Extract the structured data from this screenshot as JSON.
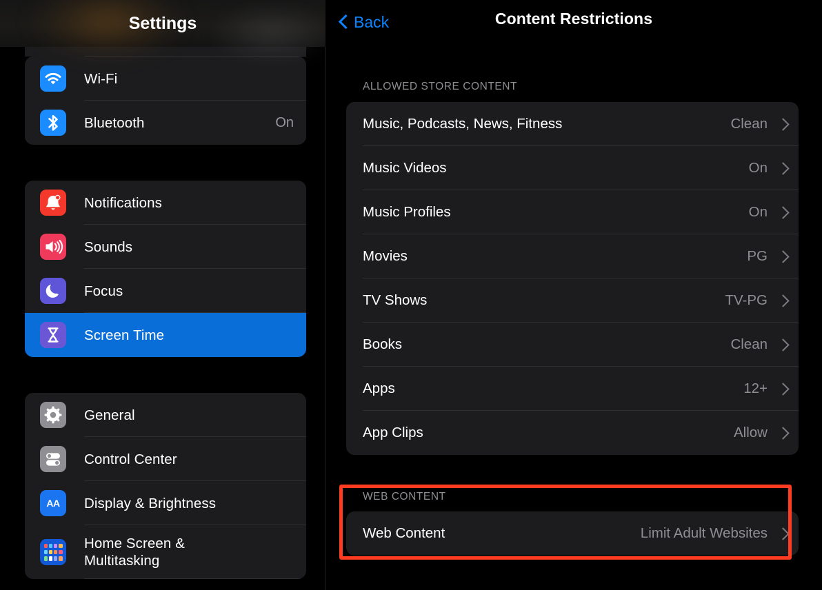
{
  "sidebar": {
    "title": "Settings",
    "peek_row": {
      "icon": "orange-app-icon",
      "toggle": "toggle-switch-off"
    },
    "groups": [
      {
        "name": "connectivity",
        "items": [
          {
            "label": "Wi-Fi",
            "value": "",
            "icon": "wifi-icon",
            "selected": false
          },
          {
            "label": "Bluetooth",
            "value": "On",
            "icon": "bluetooth-icon",
            "selected": false
          }
        ]
      },
      {
        "name": "alerts",
        "items": [
          {
            "label": "Notifications",
            "value": "",
            "icon": "bell-icon",
            "selected": false
          },
          {
            "label": "Sounds",
            "value": "",
            "icon": "speaker-icon",
            "selected": false
          },
          {
            "label": "Focus",
            "value": "",
            "icon": "moon-icon",
            "selected": false
          },
          {
            "label": "Screen Time",
            "value": "",
            "icon": "hourglass-icon",
            "selected": true
          }
        ]
      },
      {
        "name": "system",
        "items": [
          {
            "label": "General",
            "value": "",
            "icon": "gear-icon",
            "selected": false
          },
          {
            "label": "Control Center",
            "value": "",
            "icon": "sliders-icon",
            "selected": false
          },
          {
            "label": "Display & Brightness",
            "value": "",
            "icon": "aa-icon",
            "selected": false
          },
          {
            "label": "Home Screen &\nMultitasking",
            "value": "",
            "icon": "app-grid-icon",
            "selected": false
          }
        ]
      }
    ]
  },
  "panel": {
    "back_label": "Back",
    "title": "Content Restrictions",
    "sections": [
      {
        "header": "ALLOWED STORE CONTENT",
        "rows": [
          {
            "label": "Music, Podcasts, News, Fitness",
            "value": "Clean"
          },
          {
            "label": "Music Videos",
            "value": "On"
          },
          {
            "label": "Music Profiles",
            "value": "On"
          },
          {
            "label": "Movies",
            "value": "PG"
          },
          {
            "label": "TV Shows",
            "value": "TV-PG"
          },
          {
            "label": "Books",
            "value": "Clean"
          },
          {
            "label": "Apps",
            "value": "12+"
          },
          {
            "label": "App Clips",
            "value": "Allow"
          }
        ]
      },
      {
        "header": "WEB CONTENT",
        "rows": [
          {
            "label": "Web Content",
            "value": "Limit Adult Websites"
          }
        ]
      }
    ]
  },
  "annotation": {
    "color": "#ff3b21",
    "target": "web-content-section"
  },
  "colors": {
    "accent_blue": "#0a84ff",
    "selected_row": "#0a6ed9",
    "card_bg": "#1c1c1e",
    "secondary_text": "#8e8e93",
    "annotation_red": "#ff3b21"
  }
}
